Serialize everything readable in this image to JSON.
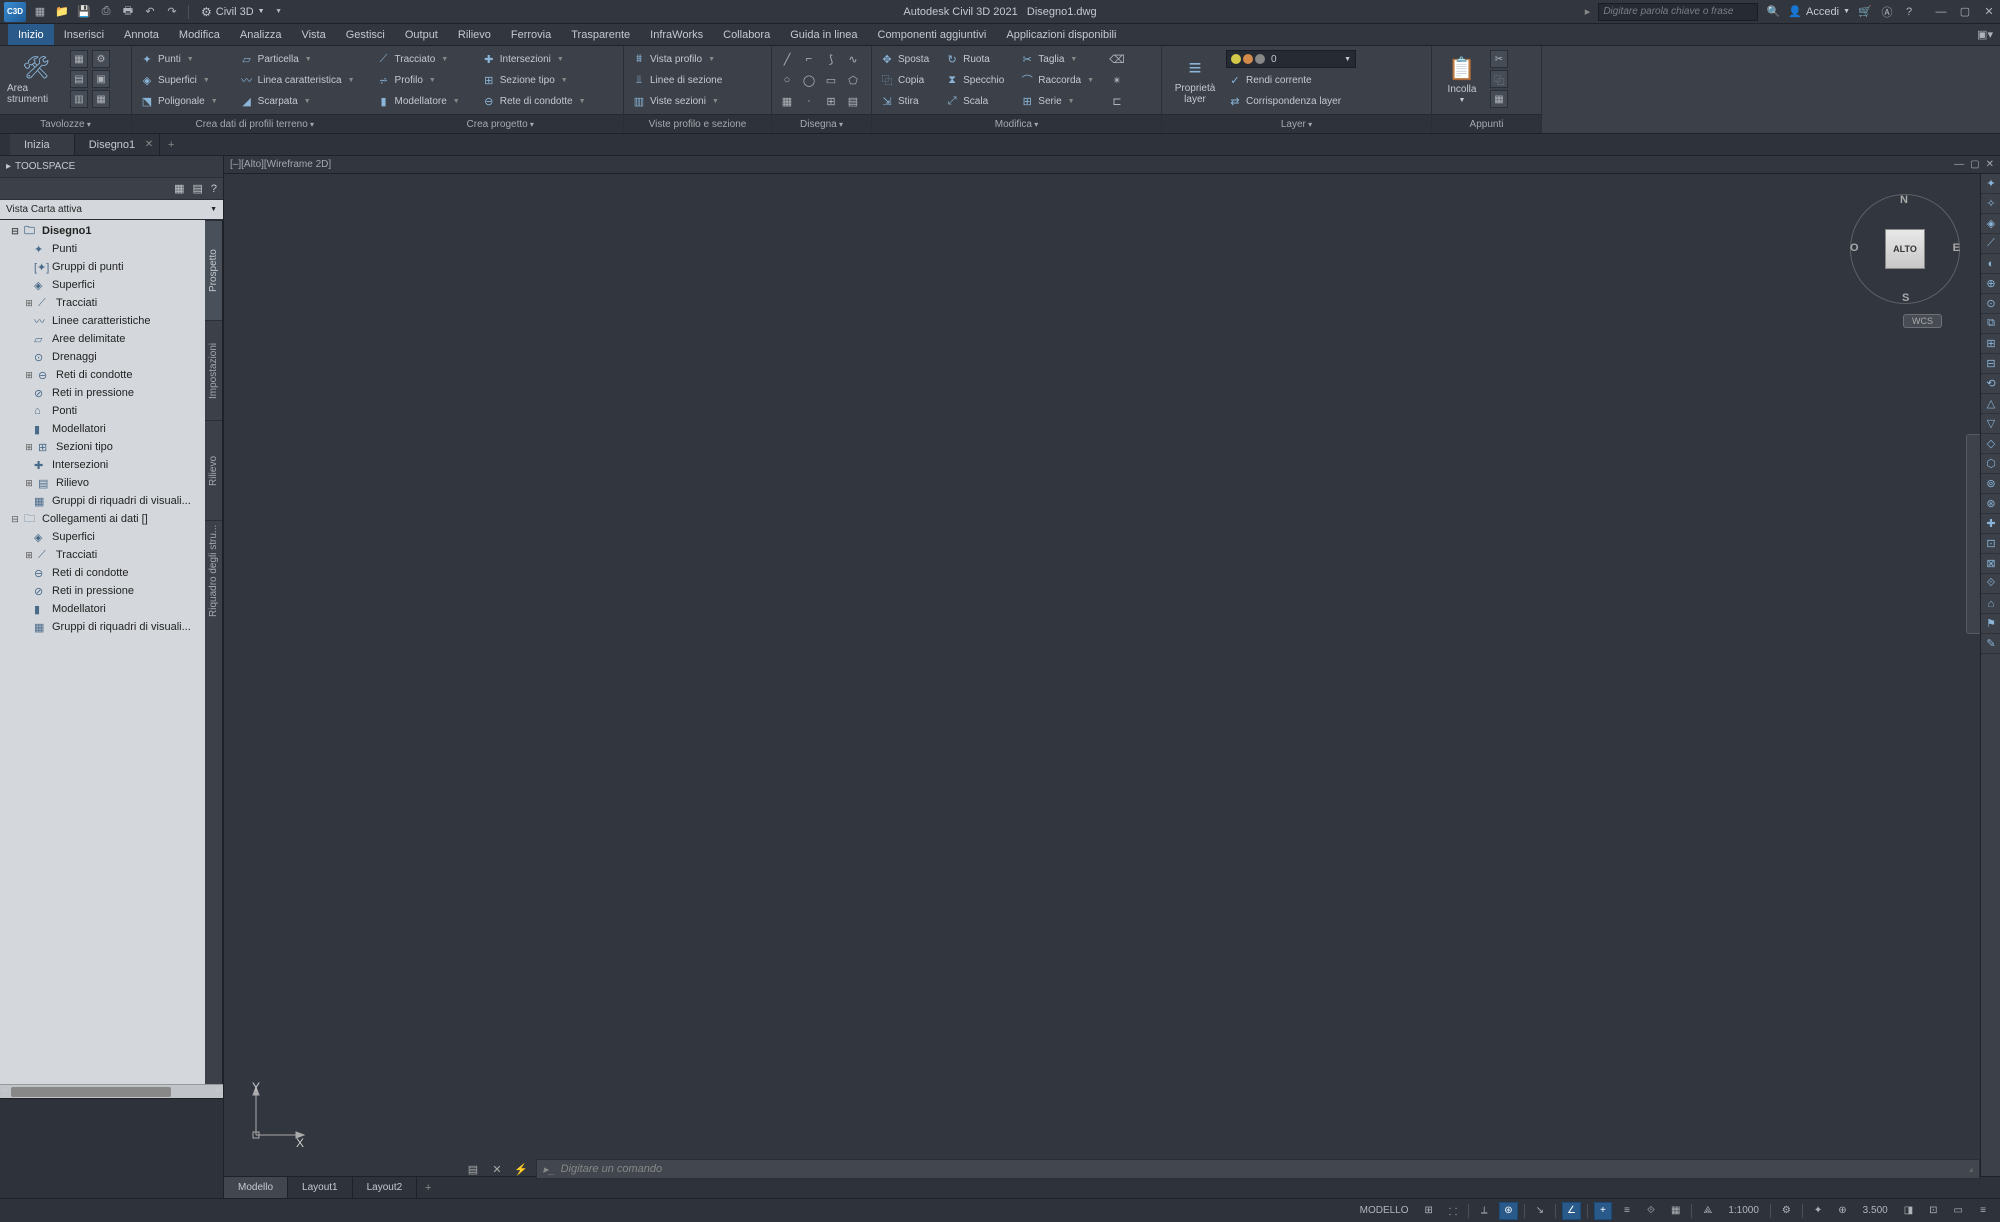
{
  "title_app": "Autodesk Civil 3D 2021",
  "title_file": "Disegno1.dwg",
  "workspace_label": "Civil 3D",
  "search_placeholder": "Digitare parola chiave o frase",
  "signin": "Accedi",
  "menu": [
    "Inizio",
    "Inserisci",
    "Annota",
    "Modifica",
    "Analizza",
    "Vista",
    "Gestisci",
    "Output",
    "Rilievo",
    "Ferrovia",
    "Trasparente",
    "InfraWorks",
    "Collabora",
    "Guida in linea",
    "Componenti aggiuntivi",
    "Applicazioni disponibili"
  ],
  "menu_active": 0,
  "ribbon": {
    "p0": {
      "title": "Tavolozze",
      "big": "Area strumenti"
    },
    "p1": {
      "title": "Crea dati di profili terreno",
      "c0": [
        "Punti",
        "Superfici",
        "Poligonale"
      ],
      "c1": [
        "Particella",
        "Linea caratteristica",
        "Scarpata"
      ],
      "c2": [
        "Tracciato",
        "Profilo",
        "Modellatore"
      ],
      "c3": [
        "Intersezioni",
        "Sezione tipo",
        "Rete di condotte"
      ]
    },
    "p2": {
      "title": "Crea progetto"
    },
    "p3": {
      "title": "Viste profilo e sezione",
      "c": [
        "Vista profilo",
        "Linee di sezione",
        "Viste sezioni"
      ]
    },
    "p4": {
      "title": "Disegna"
    },
    "p5": {
      "title": "Modifica",
      "c0": [
        "Sposta",
        "Copia",
        "Stira"
      ],
      "c1": [
        "Ruota",
        "Specchio",
        "Scala"
      ],
      "c2": [
        "Taglia",
        "Raccorda",
        "Serie"
      ]
    },
    "p6": {
      "title": "Layer",
      "big": "Proprietà layer",
      "c": [
        "Rendi corrente",
        "Corrispondenza layer"
      ],
      "layer_value": "0"
    },
    "p7": {
      "title": "Appunti",
      "big": "Incolla"
    }
  },
  "filetabs": {
    "t0": "Inizia",
    "t1": "Disegno1"
  },
  "toolspace": {
    "title": "TOOLSPACE",
    "combo": "Vista Carta attiva",
    "sidetabs": [
      "Prospetto",
      "Impostazioni",
      "Rilievo",
      "Riquadro degli stru..."
    ],
    "root": "Disegno1",
    "n": [
      "Punti",
      "Gruppi di punti",
      "Superfici",
      "Tracciati",
      "Linee caratteristiche",
      "Aree delimitate",
      "Drenaggi",
      "Reti di condotte",
      "Reti in pressione",
      "Ponti",
      "Modellatori",
      "Sezioni tipo",
      "Intersezioni",
      "Rilievo",
      "Gruppi di riquadri di visuali..."
    ],
    "root2": "Collegamenti ai dati []",
    "m": [
      "Superfici",
      "Tracciati",
      "Reti di condotte",
      "Reti in pressione",
      "Modellatori",
      "Gruppi di riquadri di visuali..."
    ]
  },
  "canvas": {
    "label": "[–][Alto][Wireframe 2D]",
    "viewcube": "ALTO",
    "wcs": "WCS",
    "n": "N",
    "s": "S",
    "e": "E",
    "o": "O",
    "y": "Y",
    "x": "X"
  },
  "cmd_placeholder": "Digitare un comando",
  "layouts": [
    "Modello",
    "Layout1",
    "Layout2"
  ],
  "status": {
    "model": "MODELLO",
    "scale": "1:1000",
    "dec": "3.500"
  }
}
